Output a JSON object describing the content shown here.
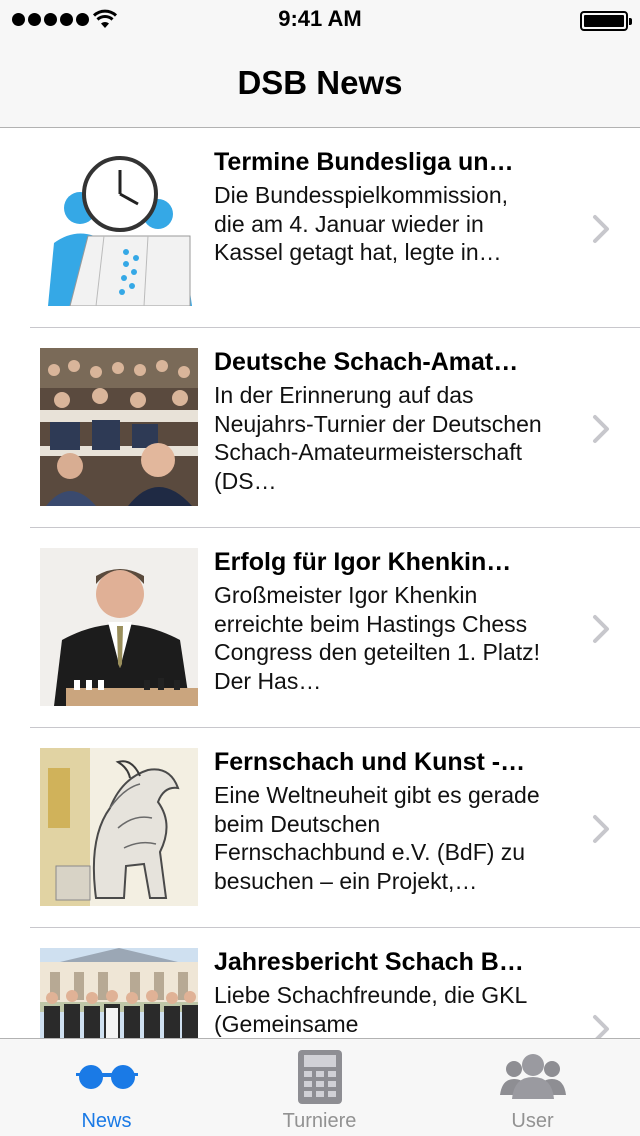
{
  "status_bar": {
    "time": "9:41 AM"
  },
  "nav": {
    "title": "DSB News"
  },
  "news": [
    {
      "title": "Termine Bundesliga un…",
      "excerpt": "Die Bundesspielkommission, die am 4. Januar wieder in Kassel getagt hat, legte in…",
      "thumb_icon": "calendar-clock-illustration"
    },
    {
      "title": "Deutsche Schach-Amat…",
      "excerpt": "In der Erinnerung auf das Neujahrs-Turnier der Deutschen Schach-Amateurmeisterschaft (DS…",
      "thumb_icon": "chess-tournament-photo"
    },
    {
      "title": "Erfolg für Igor Khenkin…",
      "excerpt": "Großmeister Igor Khenkin erreichte beim Hastings Chess Congress den geteilten 1. Platz! Der Has…",
      "thumb_icon": "chess-player-portrait"
    },
    {
      "title": "Fernschach und Kunst -…",
      "excerpt": "Eine Weltneuheit gibt es gerade beim Deutschen Fernschachbund e.V. (BdF) zu besuchen – ein Projekt,…",
      "thumb_icon": "horse-artwork"
    },
    {
      "title": "Jahresbericht Schach B…",
      "excerpt": "Liebe Schachfreunde, die GKL (Gemeinsame",
      "thumb_icon": "group-photo"
    }
  ],
  "tabs": [
    {
      "label": "News",
      "icon": "glasses-icon",
      "active": true
    },
    {
      "label": "Turniere",
      "icon": "calculator-icon",
      "active": false
    },
    {
      "label": "User",
      "icon": "users-icon",
      "active": false
    }
  ],
  "colors": {
    "accent": "#1a7ae6",
    "inactive": "#929292",
    "bar_bg": "#f7f7f7",
    "chevron": "#c7c7cc"
  }
}
